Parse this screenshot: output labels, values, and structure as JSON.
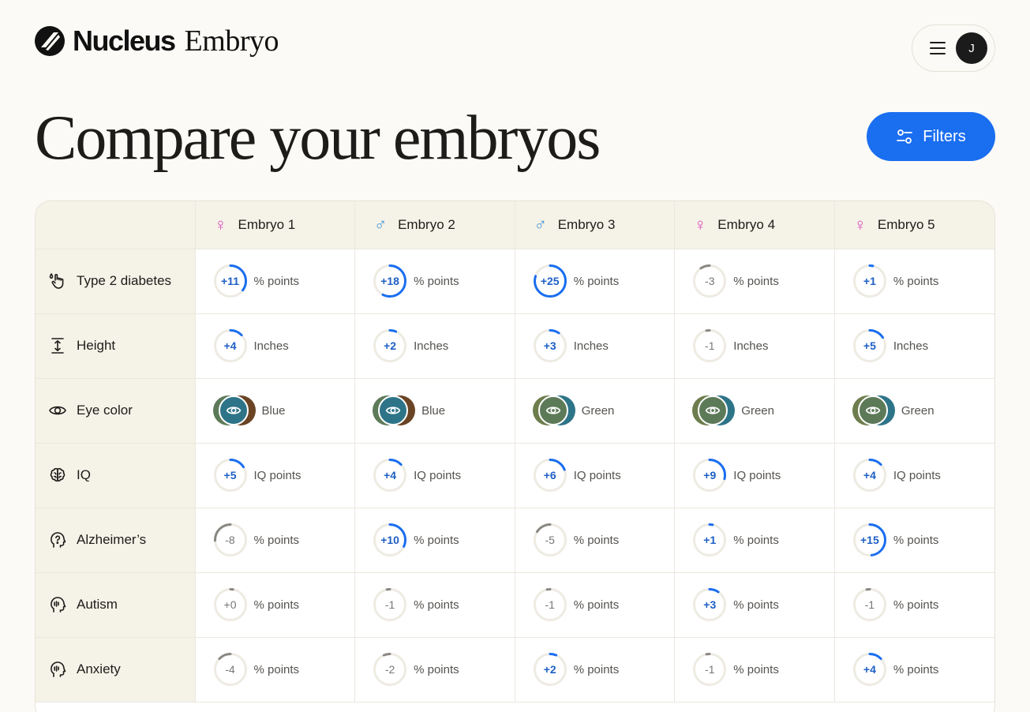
{
  "brand": {
    "name": "Nucleus",
    "product": "Embryo"
  },
  "account": {
    "avatar_initial": "J"
  },
  "page": {
    "title": "Compare your embryos",
    "filters_label": "Filters"
  },
  "colors": {
    "accent": "#1a6ef0",
    "female": "#d94fbf",
    "male": "#4a9bd6",
    "positive_text": "#1e5fc4",
    "arc_positive": "#1a6ef0",
    "arc_negative": "#8a8882",
    "eye_blue": "#2e7488",
    "eye_green": "#5d7a58",
    "eye_brown": "#6a4424",
    "eye_olive": "#6d7d4d"
  },
  "embryos": [
    {
      "label": "Embryo 1",
      "sex": "female",
      "sex_icon": "female-icon"
    },
    {
      "label": "Embryo 2",
      "sex": "male",
      "sex_icon": "male-icon"
    },
    {
      "label": "Embryo 3",
      "sex": "male",
      "sex_icon": "male-icon"
    },
    {
      "label": "Embryo 4",
      "sex": "female",
      "sex_icon": "female-icon"
    },
    {
      "label": "Embryo 5",
      "sex": "female",
      "sex_icon": "female-icon"
    }
  ],
  "traits": [
    {
      "key": "type2",
      "label": "Type 2 diabetes",
      "icon": "hand-drop-icon",
      "unit": "% points",
      "values": [
        "+11",
        "+18",
        "+25",
        "-3",
        "+1"
      ]
    },
    {
      "key": "height",
      "label": "Height",
      "icon": "height-icon",
      "unit": "Inches",
      "values": [
        "+4",
        "+2",
        "+3",
        "-1",
        "+5"
      ]
    },
    {
      "key": "eye",
      "label": "Eye color",
      "icon": "eye-icon",
      "unit": "",
      "values": [
        "Blue",
        "Blue",
        "Green",
        "Green",
        "Green"
      ]
    },
    {
      "key": "iq",
      "label": "IQ",
      "icon": "brain-icon",
      "unit": "IQ points",
      "values": [
        "+5",
        "+4",
        "+6",
        "+9",
        "+4"
      ]
    },
    {
      "key": "alz",
      "label": "Alzheimer’s",
      "icon": "head-question-icon",
      "unit": "% points",
      "values": [
        "-8",
        "+10",
        "-5",
        "+1",
        "+15"
      ]
    },
    {
      "key": "autism",
      "label": "Autism",
      "icon": "head-icon",
      "unit": "% points",
      "values": [
        "+0",
        "-1",
        "-1",
        "+3",
        "-1"
      ]
    },
    {
      "key": "anxiety",
      "label": "Anxiety",
      "icon": "head-icon",
      "unit": "% points",
      "values": [
        "-4",
        "-2",
        "+2",
        "-1",
        "+4"
      ]
    }
  ]
}
